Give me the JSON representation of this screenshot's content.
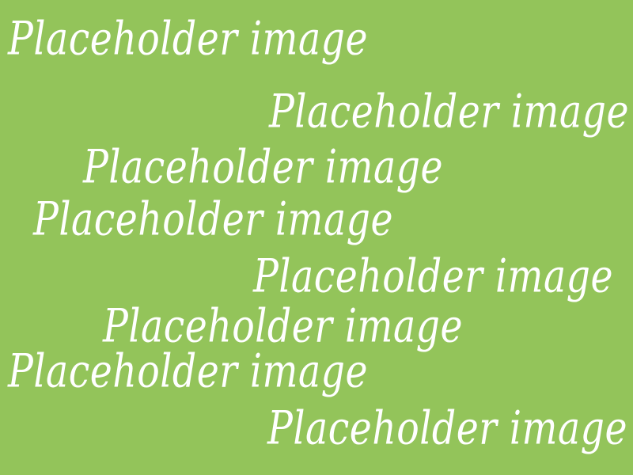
{
  "image": {
    "background_color": "#93c45a",
    "text_color": "#ffffff",
    "phrases": [
      "Placeholder image",
      "Placeholder image",
      "Placeholder image",
      "Placeholder image",
      "Placeholder image",
      "Placeholder image",
      "Placeholder image",
      "Placeholder image"
    ]
  }
}
